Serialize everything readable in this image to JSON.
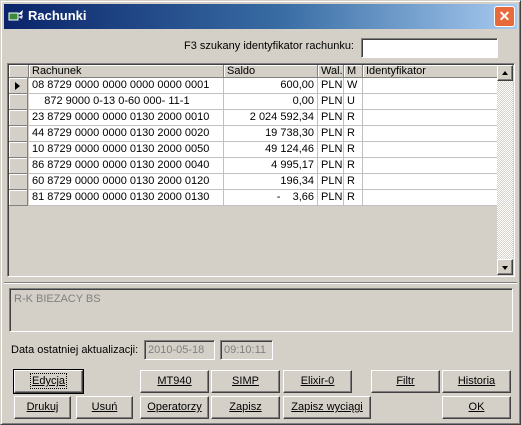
{
  "window": {
    "title": "Rachunki",
    "close_glyph": "✕",
    "icon": "money-wings-icon"
  },
  "search": {
    "label": "F3 szukany identyfikator rachunku:",
    "value": ""
  },
  "grid": {
    "columns": [
      "Rachunek",
      "Saldo",
      "Wal.",
      "M",
      "Identyfikator"
    ],
    "rows": [
      {
        "rachunek": "08 8729 0000 0000 0000 0000 0001",
        "saldo": "600,00",
        "wal": "PLN",
        "m": "W",
        "id": "",
        "current": true
      },
      {
        "rachunek": "    872 9000 0-13 0-60 000- 11-1",
        "saldo": "0,00",
        "wal": "PLN",
        "m": "U",
        "id": ""
      },
      {
        "rachunek": "23 8729 0000 0000 0130 2000 0010",
        "saldo": "2 024 592,34",
        "wal": "PLN",
        "m": "R",
        "id": ""
      },
      {
        "rachunek": "44 8729 0000 0000 0130 2000 0020",
        "saldo": "19 738,30",
        "wal": "PLN",
        "m": "R",
        "id": ""
      },
      {
        "rachunek": "10 8729 0000 0000 0130 2000 0050",
        "saldo": "49 124,46",
        "wal": "PLN",
        "m": "R",
        "id": ""
      },
      {
        "rachunek": "86 8729 0000 0000 0130 2000 0040",
        "saldo": "4 995,17",
        "wal": "PLN",
        "m": "R",
        "id": ""
      },
      {
        "rachunek": "60 8729 0000 0000 0130 2000 0120",
        "saldo": "196,34",
        "wal": "PLN",
        "m": "R",
        "id": ""
      },
      {
        "rachunek": "81 8729 0000 0000 0130 2000 0130",
        "saldo": "-    3,66",
        "wal": "PLN",
        "m": "R",
        "id": ""
      }
    ]
  },
  "memo": {
    "text": "R-K BIEZACY  BS"
  },
  "update": {
    "label": "Data ostatniej aktualizacji:",
    "date": "2010-05-18",
    "time": "09:10:11"
  },
  "buttons": {
    "edycja": "Edycja",
    "mt940": "MT940",
    "simp": "SIMP",
    "elixir": "Elixir-0",
    "filtr": "Filtr",
    "historia": "Historia",
    "drukuj": "Drukuj",
    "usun": "Usuń",
    "operatorzy": "Operatorzy",
    "zapisz": "Zapisz",
    "zapisz_wyciagi": "Zapisz wyciągi",
    "ok": "OK"
  },
  "colors": {
    "title_start": "#0a246a",
    "title_end": "#a6caf0",
    "face": "#d4d0c8",
    "close": "#e86a3a"
  }
}
